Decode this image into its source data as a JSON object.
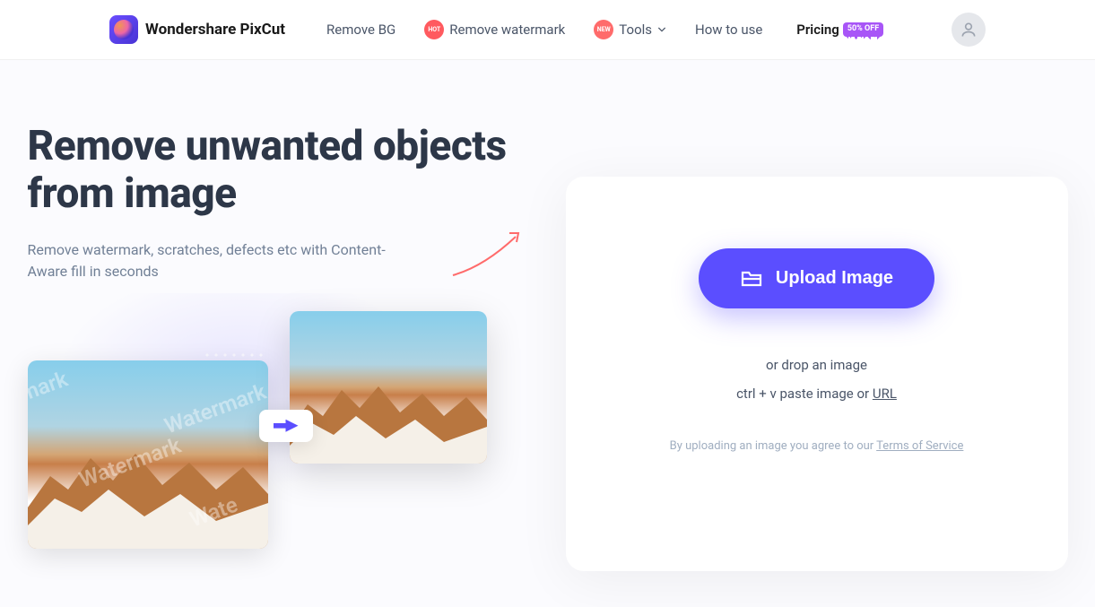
{
  "brand": {
    "name": "Wondershare PixCut"
  },
  "nav": {
    "removeBg": "Remove BG",
    "removeWatermark": "Remove watermark",
    "tools": "Tools",
    "howToUse": "How to use",
    "pricing": "Pricing",
    "hotBadge": "HOT",
    "newBadge": "NEW",
    "saleBadge": "50% OFF"
  },
  "hero": {
    "title": "Remove unwanted objects from image",
    "subtitle": "Remove watermark, scratches, defects etc with Content-Aware fill in seconds",
    "watermarkSample1": "mark",
    "watermarkSample2": "Watermark",
    "watermarkSample3": "Wate"
  },
  "upload": {
    "button": "Upload Image",
    "dropText": "or drop an image",
    "pasteText": "ctrl + v paste image or ",
    "urlLabel": "URL",
    "termsPrefix": "By uploading an image you agree to our ",
    "termsLink": "Terms of Service"
  }
}
